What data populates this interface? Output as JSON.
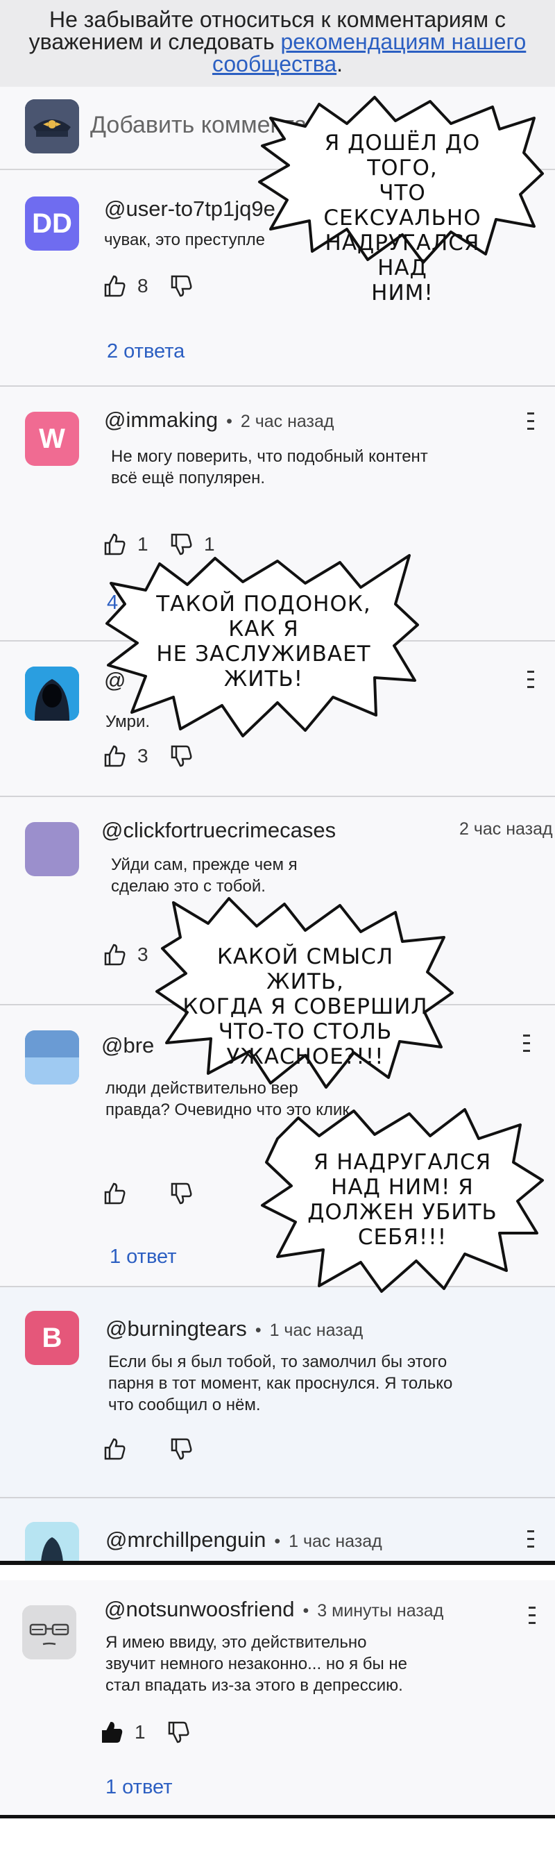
{
  "banner": {
    "line1": "Не забывайте относиться к комментариям с",
    "line2_prefix": "уважением и следовать ",
    "line2_link": "рекомендациям нашего",
    "line3_link": "сообщества",
    "line3_suffix": "."
  },
  "add_comment": {
    "placeholder": "Добавить комментарий"
  },
  "comments": [
    {
      "author": "@user-to7tp1jq9e",
      "avatar_letters": "DD",
      "avatar_color": "#6f6cf0",
      "text": [
        "чувак, это преступле"
      ],
      "likes": "8",
      "replies": "2 ответа"
    },
    {
      "author": "@immaking",
      "dot": "•",
      "time": "2 час назад",
      "avatar_letters": "W",
      "avatar_color": "#f06b92",
      "text": [
        "Не могу поверить, что подобный контент",
        "всё ещё популярен."
      ],
      "likes": "1",
      "dislikes": "1",
      "replies": "4 о"
    },
    {
      "author": "@",
      "avatar_letters": "",
      "avatar_color": "#1e8fd0",
      "text": [
        "Умри."
      ],
      "likes": "3"
    },
    {
      "author": "@clickfortruecrimecases",
      "time": "2 час назад",
      "avatar_letters": "",
      "avatar_color": "#9b8fcc",
      "text": [
        "Уйди сам, прежде чем я",
        "сделаю это с тобой."
      ],
      "likes": "3"
    },
    {
      "author": "@bre",
      "avatar_letters": "",
      "avatar_color": "#7fb6ea",
      "text": [
        "люди действительно вер",
        "правда? Очевидно что это клик"
      ],
      "replies": "1 ответ"
    },
    {
      "author": "@burningtears",
      "dot": "•",
      "time": "1 час назад",
      "avatar_letters": "B",
      "avatar_color": "#e5577a",
      "text": [
        "Если бы я был тобой, то замолчил бы этого",
        "парня в тот момент, как проснулся. Я только",
        "что сообщил о нём."
      ]
    },
    {
      "author": "@mrchillpenguin",
      "dot": "•",
      "time": "1 час назад",
      "avatar_letters": "",
      "avatar_color": "#8fd6ea"
    },
    {
      "author": "@notsunwoosfriend",
      "dot": "•",
      "time": "3 минуты назад",
      "avatar_letters": "",
      "avatar_color": "#d8d8da",
      "text": [
        "Я имею ввиду, это действительно",
        "звучит немного незаконно... но я бы не",
        "стал впадать из-за этого в депрессию."
      ],
      "likes": "1",
      "replies": "1 ответ"
    }
  ],
  "bubbles": [
    {
      "lines": [
        "Я ДОШЁЛ ДО ТОГО,",
        "ЧТО СЕКСУАЛЬНО",
        "НАДРУГАЛСЯ НАД",
        "НИМ!"
      ]
    },
    {
      "lines": [
        "ТАКОЙ ПОДОНОК,",
        "КАК Я",
        "НЕ ЗАСЛУЖИВАЕТ",
        "ЖИТЬ!"
      ]
    },
    {
      "lines": [
        "КАКОЙ СМЫСЛ ЖИТЬ,",
        "КОГДА Я СОВЕРШИЛ",
        "ЧТО-ТО СТОЛЬ",
        "УЖАСНОЕ?!!!"
      ]
    },
    {
      "lines": [
        "Я НАДРУГАЛСЯ",
        "НАД НИМ! Я",
        "ДОЛЖЕН УБИТЬ",
        "СЕБЯ!!!"
      ]
    }
  ]
}
